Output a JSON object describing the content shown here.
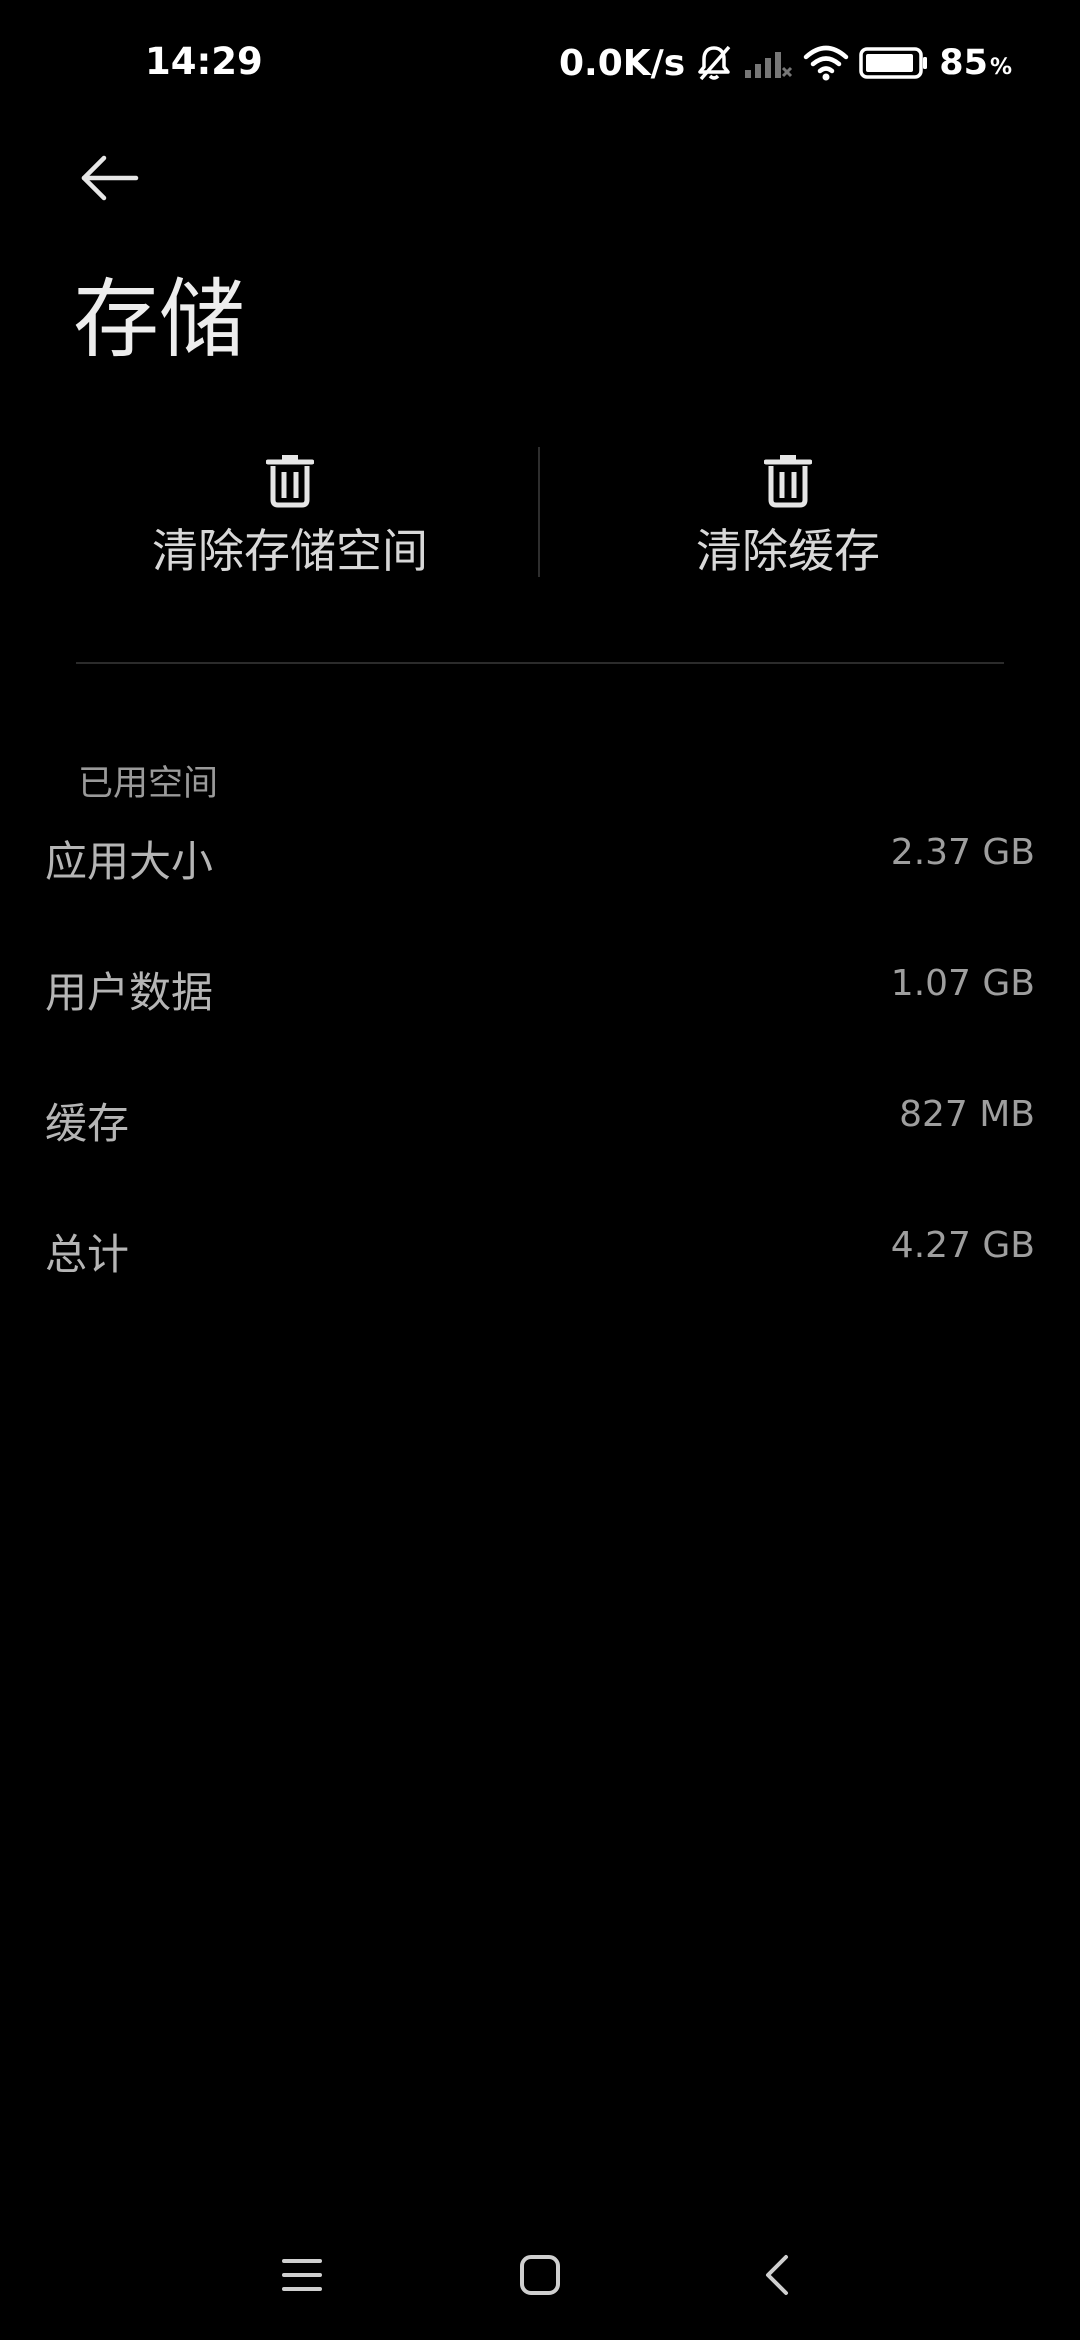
{
  "status_bar": {
    "time": "14:29",
    "net_speed": "0.0K/s",
    "battery_level": "85",
    "battery_unit": "%",
    "icons": [
      "bell-off-icon",
      "signal-icon",
      "wifi-icon",
      "battery-icon"
    ]
  },
  "header": {
    "back_icon": "arrow-left-icon",
    "title": "存储"
  },
  "actions": {
    "clear_storage_label": "清除存储空间",
    "clear_cache_label": "清除缓存",
    "icon": "trash-icon"
  },
  "storage": {
    "section_title": "已用空间",
    "rows": [
      {
        "label": "应用大小",
        "value": "2.37 GB"
      },
      {
        "label": "用户数据",
        "value": "1.07 GB"
      },
      {
        "label": "缓存",
        "value": "827 MB"
      },
      {
        "label": "总计",
        "value": "4.27 GB"
      }
    ]
  },
  "nav_bar": {
    "icons": [
      "menu-icon",
      "home-icon",
      "back-icon"
    ]
  },
  "colors": {
    "background": "#000000",
    "title_text": "#ededed",
    "secondary_text": "#9a9a9a"
  }
}
